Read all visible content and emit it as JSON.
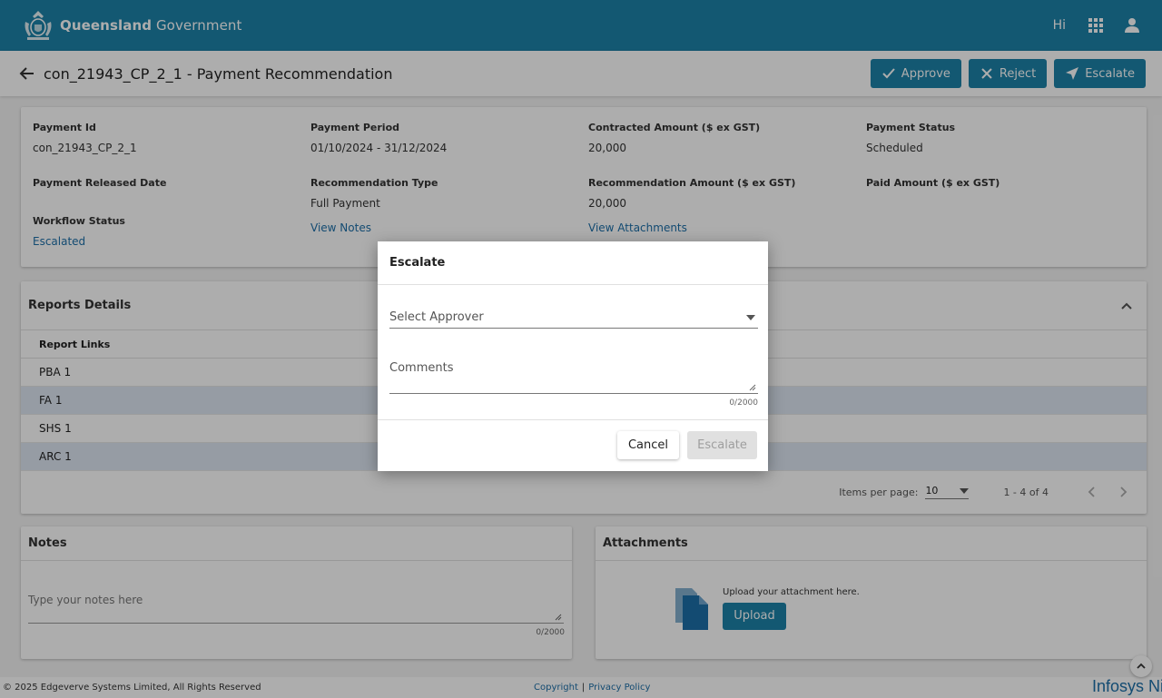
{
  "header": {
    "brand_bold": "Queensland",
    "brand_regular": " Government",
    "greeting": "Hi",
    "apps_icon": "apps-grid-icon",
    "user_icon": "person-icon",
    "color": "#1d82a8"
  },
  "subheader": {
    "title": "con_21943_CP_2_1  - Payment Recommendation",
    "approve_label": "Approve",
    "reject_label": "Reject",
    "escalate_label": "Escalate"
  },
  "details": {
    "payment_id_label": "Payment Id",
    "payment_id": "con_21943_CP_2_1",
    "payment_period_label": "Payment Period",
    "payment_period": "01/10/2024 - 31/12/2024",
    "contracted_amount_label": "Contracted Amount ($ ex GST)",
    "contracted_amount": "20,000",
    "payment_status_label": "Payment Status",
    "payment_status": "Scheduled",
    "released_date_label": "Payment Released Date",
    "recommendation_type_label": "Recommendation Type",
    "recommendation_type": "Full Payment",
    "recommendation_amount_label": "Recommendation Amount ($ ex GST)",
    "recommendation_amount": "20,000",
    "paid_amount_label": "Paid Amount ($ ex GST)",
    "workflow_status_label": "Workflow Status",
    "workflow_status": "Escalated",
    "view_notes": "View Notes",
    "view_attachments": "View Attachments"
  },
  "reports": {
    "title": "Reports Details",
    "column": "Report Links",
    "rows": [
      "PBA 1",
      "FA 1",
      "SHS 1",
      "ARC 1"
    ],
    "items_per_page_label": "Items per page:",
    "items_per_page": "10",
    "range": "1 - 4 of 4"
  },
  "notes": {
    "title": "Notes",
    "placeholder": "Type your notes here",
    "count": "0/2000"
  },
  "attachments": {
    "title": "Attachments",
    "hint": "Upload your attachment here.",
    "upload_label": "Upload"
  },
  "footer": {
    "copyright": "© 2025 Edgeverve Systems Limited, All Rights Reserved",
    "copyright_link": "Copyright",
    "separator": "|",
    "privacy_link": "Privacy Policy",
    "logo_text": "Infosys Ni"
  },
  "dialog": {
    "title": "Escalate",
    "select_placeholder": "Select Approver",
    "comments_placeholder": "Comments",
    "count": "0/2000",
    "cancel_label": "Cancel",
    "escalate_label": "Escalate"
  }
}
